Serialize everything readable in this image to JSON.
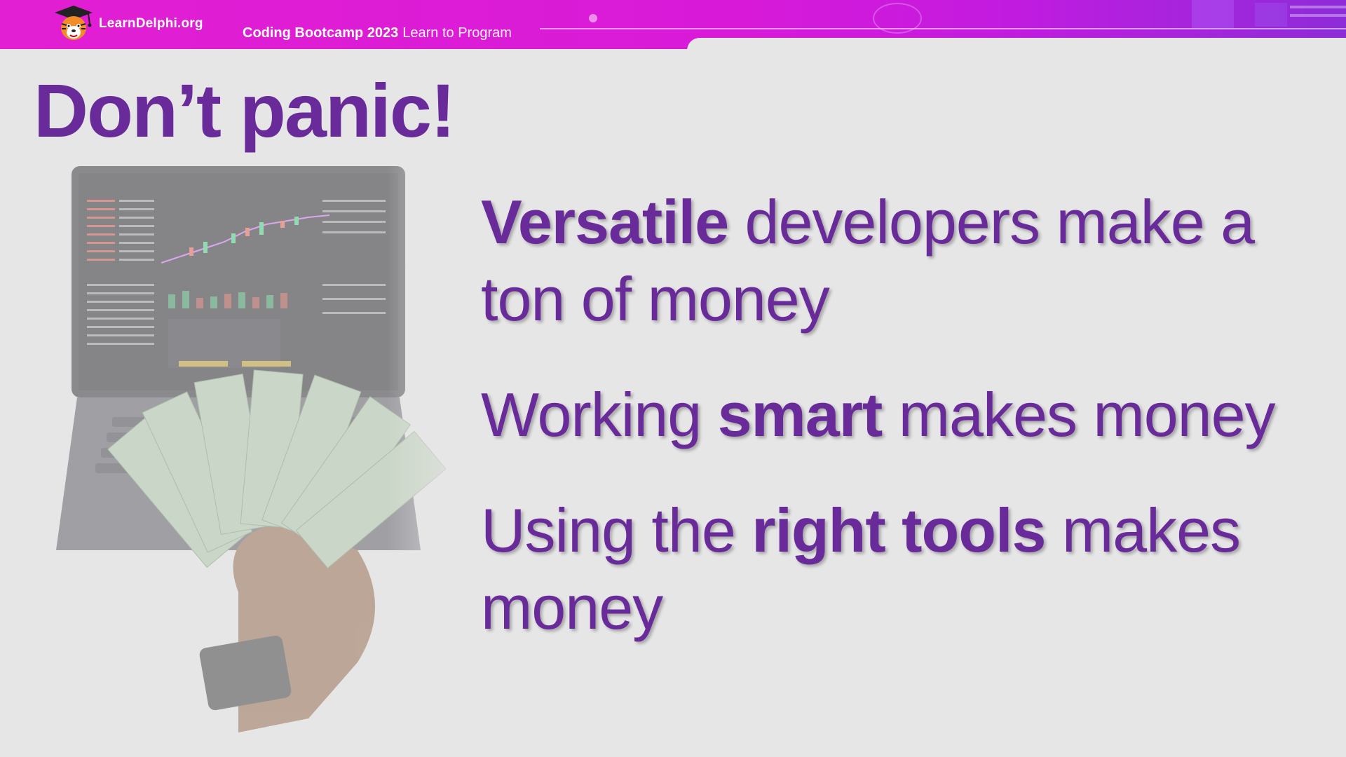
{
  "header": {
    "brand": "LearnDelphi.org",
    "event": "Coding Bootcamp 2023",
    "subtitle": "Learn to Program",
    "logo_icon": "tiger-graduate-mascot-icon"
  },
  "colors": {
    "accent_purple": "#6a2b9a",
    "header_magenta": "#e21fd2",
    "background": "#e6e6e6"
  },
  "slide": {
    "title": "Don’t panic!",
    "illustration_icon": "laptop-trading-chart-money-illustration",
    "points": [
      {
        "bold": "Versatile",
        "rest": " developers make a ton of money"
      },
      {
        "pre": "Working ",
        "bold": "smart",
        "rest": " makes money"
      },
      {
        "pre": "Using the ",
        "bold": "right tools",
        "rest": " makes money"
      }
    ]
  }
}
